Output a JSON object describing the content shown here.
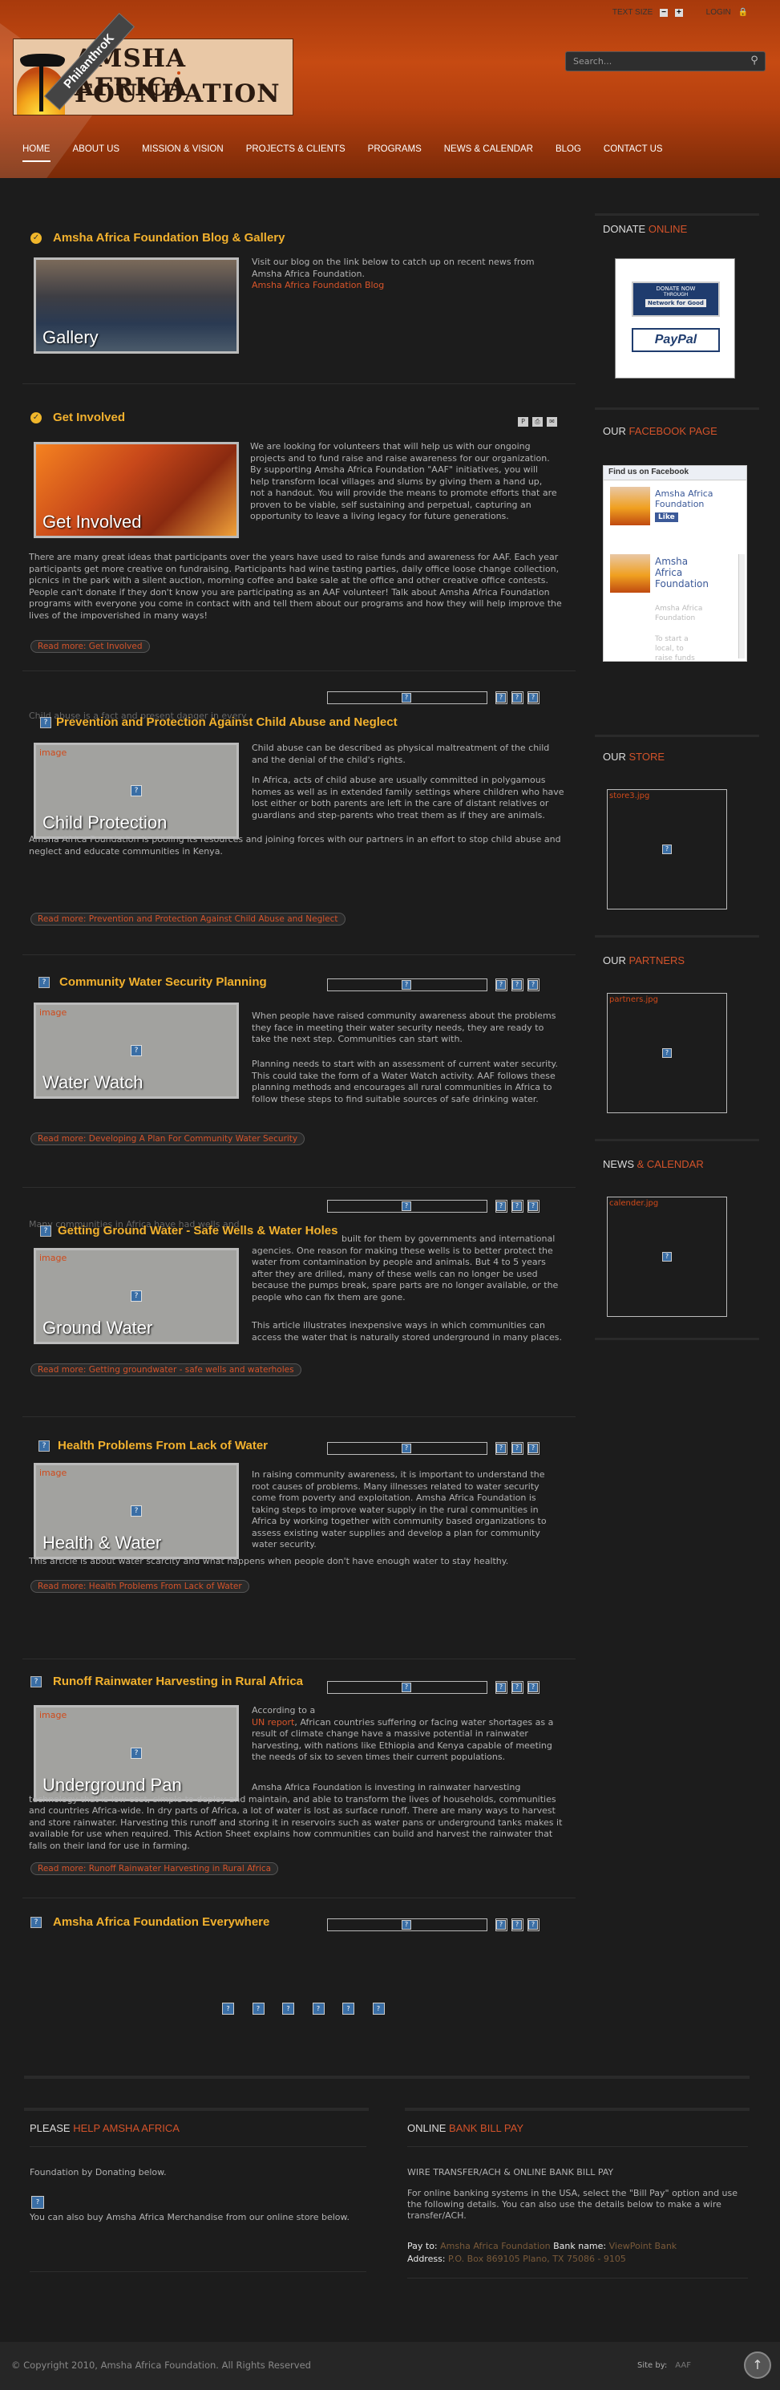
{
  "header": {
    "text_size_label": "TEXT SIZE",
    "minus": "−",
    "plus": "+",
    "login_label": "LOGIN",
    "ribbon_text": "PhilanthroK",
    "logo_line1": "AMSHA AFRICA",
    "logo_line2": "FOUNDATION",
    "search_placeholder": "Search...",
    "nav": [
      "HOME",
      "ABOUT US",
      "MISSION & VISION",
      "PROJECTS & CLIENTS",
      "PROGRAMS",
      "NEWS & CALENDAR",
      "BLOG",
      "CONTACT US"
    ]
  },
  "articles": [
    {
      "title": "Amsha Africa Foundation Blog & Gallery",
      "image_caption": "Gallery",
      "text": "Visit our blog on the link below to catch up on recent news from Amsha Africa Foundation.",
      "link": "Amsha Africa Foundation Blog"
    },
    {
      "title": "Get Involved",
      "image_caption": "Get Involved",
      "text": "We are looking for volunteers that will help us with our ongoing projects and to fund raise and raise awareness for our organization. By supporting Amsha Africa Foundation \"AAF\" initiatives, you will help transform local villages and slums by giving them a hand up, not a handout. You will provide the means to promote efforts that are proven to be viable, self sustaining and perpetual, capturing an opportunity to leave a living legacy for future generations.",
      "text2": "There are many great ideas that participants over the years have used to raise funds and awareness for AAF. Each year participants get more creative on fundraising. Participants had wine tasting parties, daily office loose change collection, picnics in the park with a silent auction, morning coffee and bake sale at the office and other creative office contests. People can't donate if they don't know you are participating as an AAF volunteer! Talk about Amsha Africa Foundation programs with everyone you come in contact with and tell them about our programs and how they will help improve the lives of the impoverished in many ways!",
      "readmore": "Read more: Get Involved"
    },
    {
      "title": "Prevention and Protection Against Child Abuse and Neglect",
      "overlay_text": "Child abuse is a fact and present danger in every",
      "image_label": "image",
      "image_caption": "Child Protection",
      "text": "Child abuse can be described as physical maltreatment of the child and the denial of the child's rights.",
      "text2": "In Africa, acts of child abuse are usually committed in polygamous homes as well as in extended family settings where children who have lost either or both parents are left in the care of distant relatives or guardians and step-parents who treat them as if they are animals.",
      "text3": "Amsha Africa Foundation is pooling its resources and joining forces with our partners in an effort to stop child abuse and neglect and educate communities in Kenya.",
      "readmore": "Read more: Prevention and Protection Against Child Abuse and Neglect"
    },
    {
      "title": "Community Water Security Planning",
      "image_label": "image",
      "image_caption": "Water Watch",
      "text": "When people have raised community awareness about the problems they face in meeting their water security needs, they are ready to take the next step. Communities can start with.",
      "text2": "Planning needs to start with an assessment of current water security. This could take the form of a Water Watch activity. AAF follows these planning methods and encourages all rural communities in Africa to follow these steps to find suitable sources of safe drinking water.",
      "readmore": "Read more: Developing A Plan For Community Water Security"
    },
    {
      "title": "Getting Ground Water - Safe Wells & Water Holes",
      "overlay_text": "Many communities in Africa have had wells and",
      "image_label": "image",
      "image_caption": "Ground Water",
      "text": "built for them by governments and international agencies. One reason for making these wells is to better protect the water from contamination by people and animals. But 4 to 5 years after they are drilled, many of these wells can no longer be used because the pumps break, spare parts are no longer available, or the people who can fix them are gone.",
      "text2": "This article illustrates inexpensive ways in which communities can access the water that is naturally stored underground in many places.",
      "readmore": "Read more: Getting groundwater - safe wells and waterholes"
    },
    {
      "title": "Health Problems From Lack of Water",
      "image_label": "image",
      "image_caption": "Health & Water",
      "text": "In raising community awareness, it is important to understand the root causes of problems. Many illnesses related to water security come from poverty and exploitation. Amsha Africa Foundation is taking steps to improve water supply in the rural communities in Africa by working together with community based organizations to assess existing water supplies and develop a plan for community water security.",
      "text2": "This article is about water scarcity and what happens when people don't have enough water to stay healthy.",
      "readmore": "Read more: Health Problems From Lack of Water"
    },
    {
      "title": "Runoff Rainwater Harvesting in Rural Africa",
      "image_label": "image",
      "image_caption": "Underground Pan",
      "text_pre": "According to a",
      "text_link": "UN report",
      "text": ", African countries suffering or facing water shortages as a result of climate change have a massive potential in rainwater harvesting, with nations like Ethiopia and Kenya capable of meeting the needs of six to seven times their current populations.",
      "text2": "Amsha Africa Foundation is investing in rainwater harvesting technology that is low cost, simple to deploy and maintain, and able to transform the lives of households, communities and countries Africa-wide. In dry parts of Africa, a lot of water is lost as surface runoff. There are many ways to harvest and store rainwater. Harvesting this runoff and storing it in reservoirs such as water pans or underground tanks makes it available for use when required. This Action Sheet explains how communities can build and harvest the rainwater that falls on their land for use in farming.",
      "readmore": "Read more: Runoff Rainwater Harvesting in Rural Africa"
    },
    {
      "title": "Amsha Africa Foundation Everywhere"
    }
  ],
  "sidebar": {
    "donate": {
      "head": "DONATE",
      "hl": "ONLINE",
      "nfg_top": "DONATE NOW",
      "nfg_through": "THROUGH",
      "nfg_btn": "Network for Good",
      "paypal": "PayPal"
    },
    "facebook": {
      "head": "OUR",
      "hl": "FACEBOOK PAGE",
      "box_title": "Find us on Facebook",
      "page_name": "Amsha Africa Foundation",
      "like": "Like",
      "page_name2": "Amsha Africa Foundation",
      "faded": "Amsha Africa Foundation",
      "faded2": "To start a local, to raise funds"
    },
    "store": {
      "head": "OUR",
      "hl": "STORE",
      "img": "store3.jpg"
    },
    "partners": {
      "head": "OUR",
      "hl": "PARTNERS",
      "img": "partners.jpg"
    },
    "news": {
      "head": "NEWS",
      "hl": "& CALENDAR",
      "img": "calender.jpg"
    }
  },
  "bottom": {
    "left": {
      "head": "PLEASE",
      "hl": "HELP AMSHA AFRICA",
      "line1": "Foundation by Donating below.",
      "line2": "You can also buy Amsha Africa Merchandise from our online store below."
    },
    "right": {
      "head": "ONLINE",
      "hl": "BANK BILL PAY",
      "line1": "WIRE TRANSFER/ACH & ONLINE BANK BILL PAY",
      "line2": "For online banking systems in the USA, select the \"Bill Pay\" option and use the following details. You can also use the details below to make a wire transfer/ACH.",
      "payto_label": "Pay to:",
      "payto": "Amsha Africa Foundation",
      "bank_label": "Bank name:",
      "bank": "ViewPoint Bank",
      "addr_label": "Address:",
      "addr": "P.O. Box 869105 Plano, TX 75086 - 9105"
    }
  },
  "footer": {
    "copyright": "© Copyright 2010, Amsha Africa Foundation. All Rights Reserved",
    "site_by": "Site by:",
    "site_by_name": "AAF",
    "totop": "↑"
  }
}
